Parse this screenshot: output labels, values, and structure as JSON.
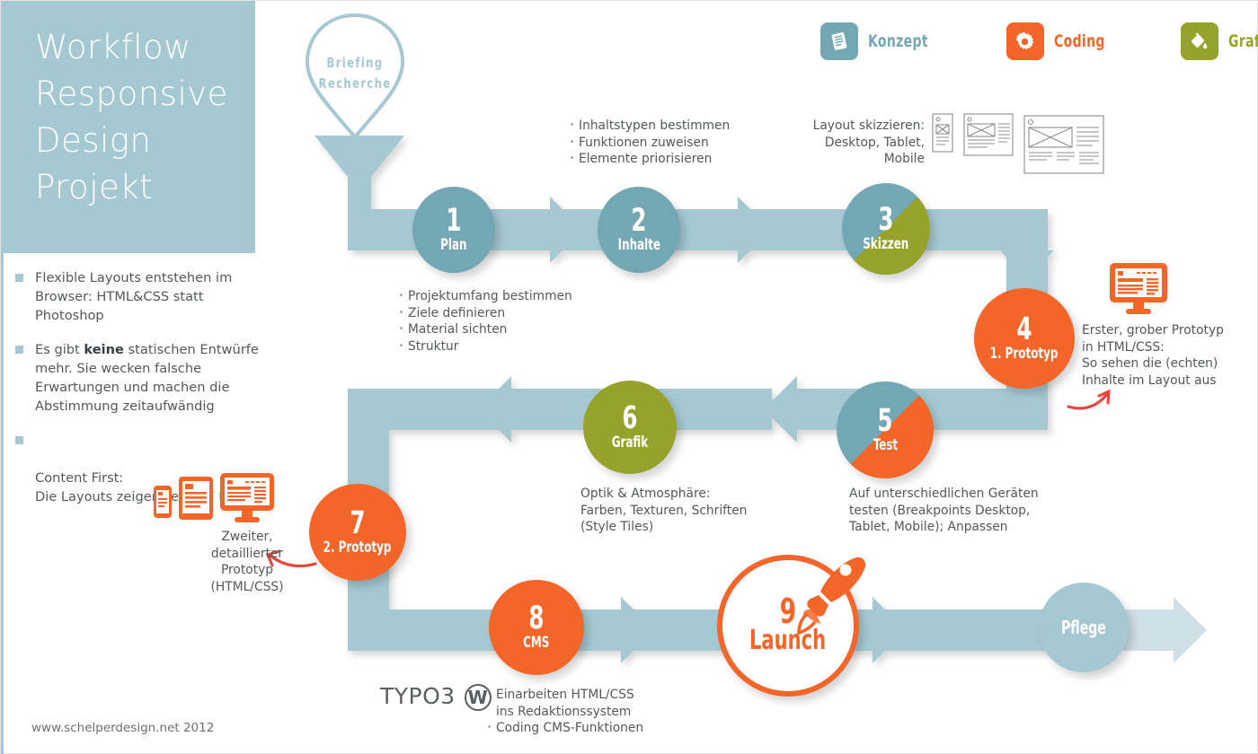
{
  "title": "Workflow\nResponsive\nDesign\nProjekt",
  "colors": {
    "blue": "#73a7b4",
    "blue_light": "#a5c8d2",
    "blue_pale": "#c3dae1",
    "orange": "#f4652a",
    "olive": "#97a22b",
    "olive_dark": "#8d9a29",
    "text": "#54585a",
    "red_arrow": "#e8453c"
  },
  "bullets": [
    {
      "pre": "Flexible Layouts entstehen im Browser: HTML&CSS statt Photoshop",
      "bold": "",
      "post": ""
    },
    {
      "pre": "Es gibt ",
      "bold": "keine",
      "post": " statischen Entwürfe mehr. Sie wecken falsche Erwartungen und machen die Abstimmung zeitaufwändig"
    },
    {
      "pre": "Content First:\nDie Layouts zeigen “echte” Inhalte",
      "bold": "",
      "post": ""
    }
  ],
  "footer": "www.schelperdesign.net 2012",
  "legend": [
    {
      "label": "Konzept",
      "color": "#73a7b4",
      "icon": "document-icon"
    },
    {
      "label": "Coding",
      "color": "#f4652a",
      "icon": "gear-icon"
    },
    {
      "label": "Grafik",
      "color": "#97a22b",
      "icon": "paint-bucket-icon"
    }
  ],
  "pin": {
    "line1": "Briefing",
    "line2": "Recherche"
  },
  "steps": [
    {
      "num": "1",
      "cap": "Plan",
      "type": "solid",
      "color": "#73a7b4"
    },
    {
      "num": "2",
      "cap": "Inhalte",
      "type": "solid",
      "color": "#73a7b4"
    },
    {
      "num": "3",
      "cap": "Skizzen",
      "type": "split",
      "color": "#73a7b4",
      "color2": "#97a22b"
    },
    {
      "num": "4",
      "cap": "1. Prototyp",
      "type": "solid",
      "color": "#f4652a"
    },
    {
      "num": "5",
      "cap": "Test",
      "type": "split",
      "color": "#73a7b4",
      "color2": "#f4652a"
    },
    {
      "num": "6",
      "cap": "Grafik",
      "type": "solid",
      "color": "#97a22b"
    },
    {
      "num": "7",
      "cap": "2. Prototyp",
      "type": "solid",
      "color": "#f4652a"
    },
    {
      "num": "8",
      "cap": "CMS",
      "type": "solid",
      "color": "#f4652a"
    },
    {
      "num": "9",
      "cap": "Launch",
      "type": "outline",
      "color": "#f4652a"
    }
  ],
  "maintenance": {
    "num": "",
    "cap": "Pflege",
    "color": "#a5c8d2"
  },
  "notes": {
    "step2": [
      "Inhaltstypen bestimmen",
      "Funktionen zuweisen",
      "Elemente priorisieren"
    ],
    "step3": "Layout skizzieren:\nDesktop, Tablet, Mobile",
    "step1": [
      "Projektumfang bestimmen",
      "Ziele definieren",
      "Material sichten",
      "Struktur"
    ],
    "step4": "Erster, grober Prototyp\nin HTML/CSS:\nSo sehen die (echten)\nInhalte im Layout aus",
    "step5": "Auf unterschiedlichen Geräten\ntesten (Breakpoints Desktop,\nTablet, Mobile); Anpassen",
    "step6": "Optik & Atmosphäre:\nFarben, Texturen, Schriften\n(Style Tiles)",
    "step7": "Zweiter, detaillierter\nPrototyp (HTML/CSS)",
    "step8": [
      "Einarbeiten HTML/CSS",
      "ins Redaktionssystem",
      "Coding CMS-Funktionen"
    ]
  },
  "cms": {
    "typo3": "TYPO3",
    "wordpress_mark": "W"
  }
}
